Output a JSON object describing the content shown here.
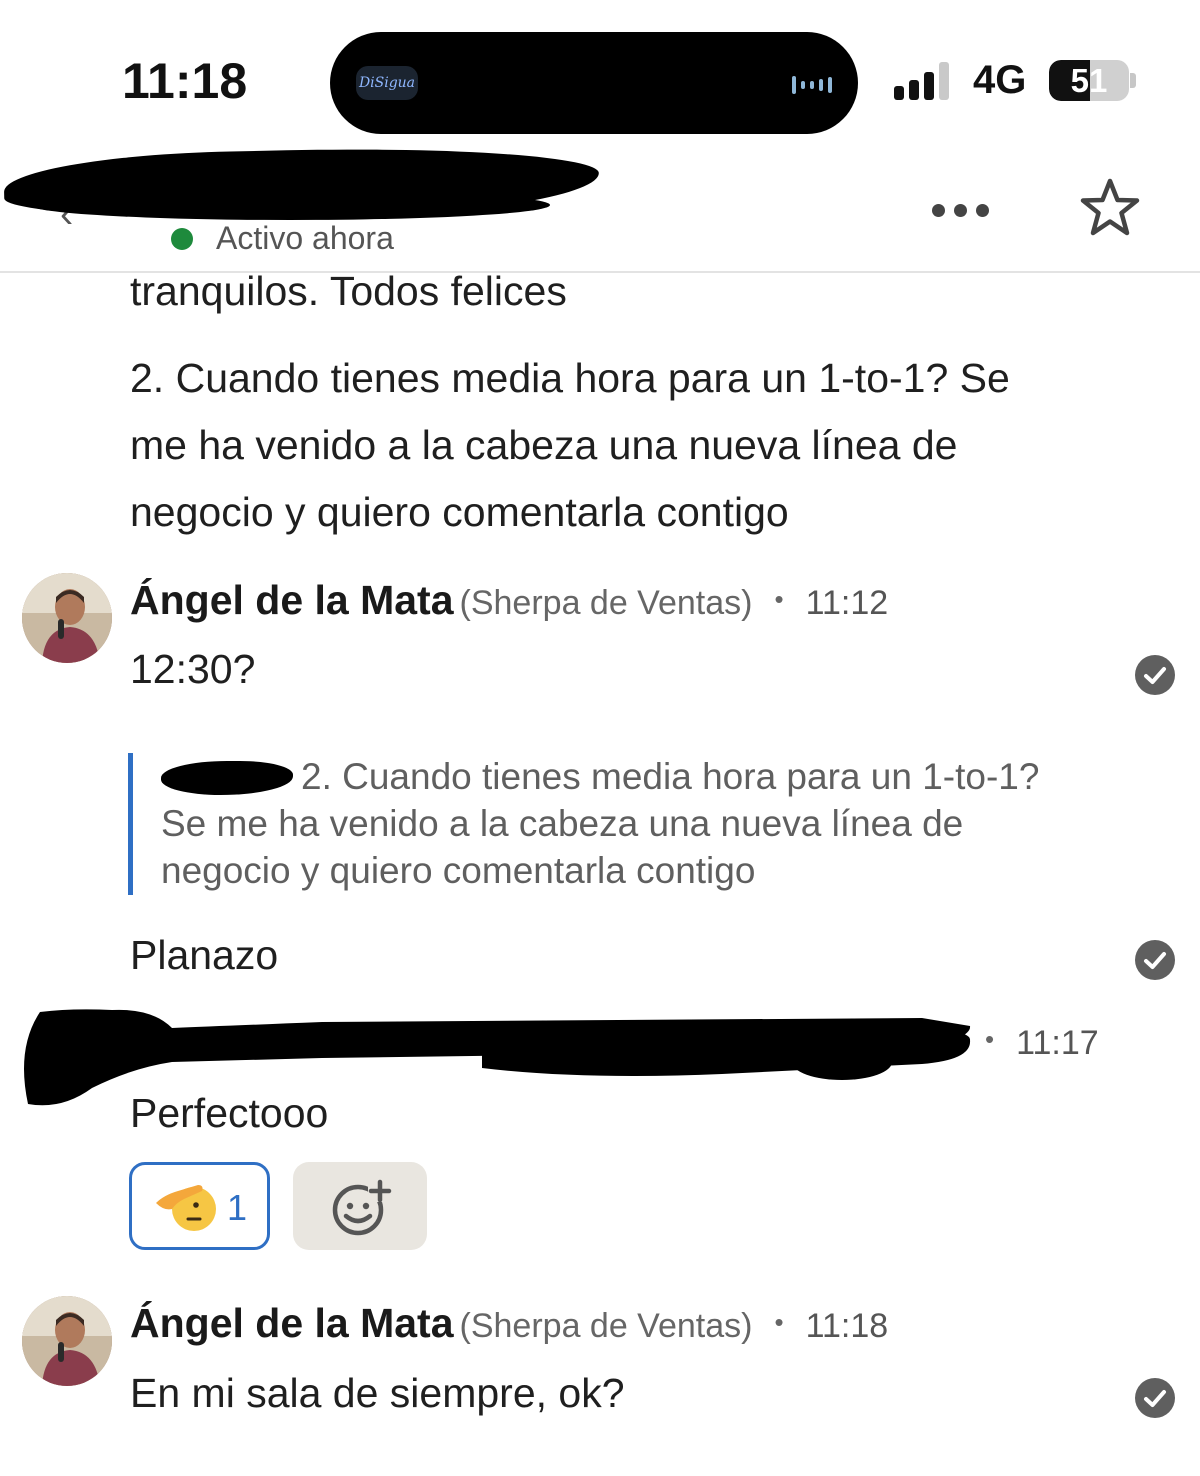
{
  "status_bar": {
    "time": "11:18",
    "island_app": "DiSigua",
    "network": "4G",
    "battery": "51",
    "battery_level": 0.51
  },
  "header": {
    "presence": "Activo ahora",
    "icons": [
      "back-icon",
      "more-icon",
      "star-icon"
    ]
  },
  "messages": {
    "partial_line": "tranquilos. Todos felices",
    "msg_2_lines": [
      "2. Cuando tienes media hora para un 1-to-1? Se",
      "me ha venido a la cabeza una nueva línea de",
      "negocio y quiero comentarla contigo"
    ],
    "group_1": {
      "sender": "Ángel de la Mata",
      "role": "(Sherpa de Ventas)",
      "separator": "•",
      "time": "11:12",
      "text": "12:30?"
    },
    "quote": {
      "lines": [
        "2. Cuando tienes media hora para un 1-to-1?",
        "Se me ha venido a la cabeza una nueva línea de",
        "negocio y quiero comentarla contigo"
      ]
    },
    "reply_text": "Planazo",
    "group_2": {
      "separator": "•",
      "time": "11:17",
      "text": "Perfectooo",
      "reaction_count": "1",
      "reaction_icon": "saluting-face-icon",
      "add_reaction_icon": "add-reaction-icon"
    },
    "group_3": {
      "sender": "Ángel de la Mata",
      "role": "(Sherpa de Ventas)",
      "separator": "•",
      "time": "11:18",
      "text": "En mi sala de siempre, ok?"
    }
  },
  "colors": {
    "accent": "#2f6fc4",
    "presence": "#1e8a3c",
    "read_receipt": "#5f5f5f",
    "add_reaction_bg": "#e9e6e0"
  }
}
